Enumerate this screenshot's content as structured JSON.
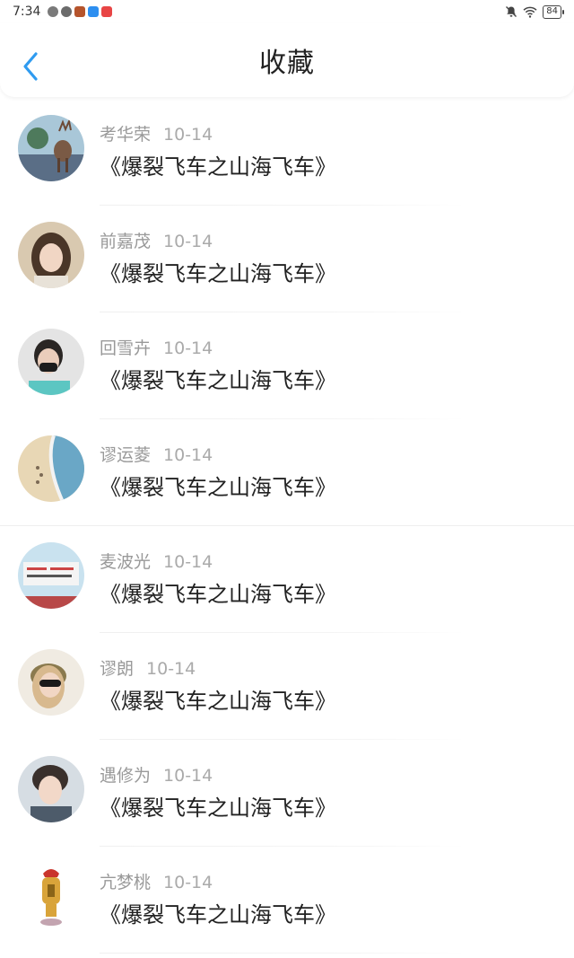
{
  "status_bar": {
    "time": "7:34",
    "battery": "84"
  },
  "header": {
    "title": "收藏"
  },
  "favorites": [
    {
      "name": "考华荣",
      "date": "10-14",
      "game": "《爆裂飞车之山海飞车》"
    },
    {
      "name": "前嘉茂",
      "date": "10-14",
      "game": "《爆裂飞车之山海飞车》"
    },
    {
      "name": "回雪卉",
      "date": "10-14",
      "game": "《爆裂飞车之山海飞车》"
    },
    {
      "name": "谬运菱",
      "date": "10-14",
      "game": "《爆裂飞车之山海飞车》"
    },
    {
      "name": "麦波光",
      "date": "10-14",
      "game": "《爆裂飞车之山海飞车》"
    },
    {
      "name": "谬朗",
      "date": "10-14",
      "game": "《爆裂飞车之山海飞车》"
    },
    {
      "name": "遇修为",
      "date": "10-14",
      "game": "《爆裂飞车之山海飞车》"
    },
    {
      "name": "亢梦桃",
      "date": "10-14",
      "game": "《爆裂飞车之山海飞车》"
    }
  ]
}
